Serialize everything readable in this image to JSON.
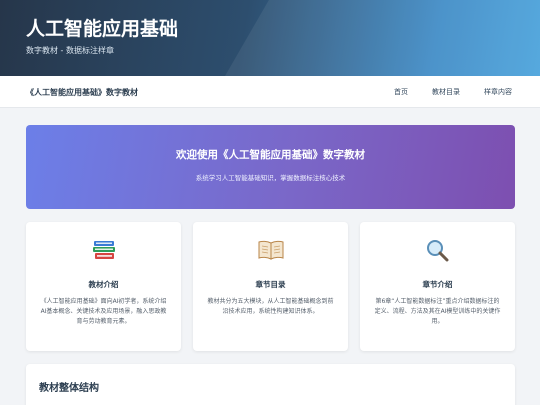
{
  "hero": {
    "title": "人工智能应用基础",
    "subtitle": "数字教材 - 数据标注样章"
  },
  "navbar": {
    "brand": "《人工智能应用基础》数字教材",
    "links": [
      "首页",
      "教材目录",
      "样章内容"
    ]
  },
  "banner": {
    "title": "欢迎使用《人工智能应用基础》数字教材",
    "subtitle": "系统学习人工智能基础知识，掌握数据标注核心技术"
  },
  "cards": [
    {
      "icon": "books-icon",
      "title": "教材介绍",
      "text": "《人工智能应用基础》面向AI初学者，系统介绍AI基本概念、关键技术及应用场景，融入思政教育与劳动教育元素。"
    },
    {
      "icon": "open-book-icon",
      "title": "章节目录",
      "text": "教材共分为五大模块，从人工智能基础概念到前沿技术应用，系统性构建知识体系。"
    },
    {
      "icon": "magnifier-icon",
      "title": "章节介绍",
      "text": "第6章“人工智能数据标注”重点介绍数据标注的定义、流程、方法及其在AI模型训练中的关键作用。"
    }
  ],
  "section": {
    "title": "教材整体结构"
  }
}
